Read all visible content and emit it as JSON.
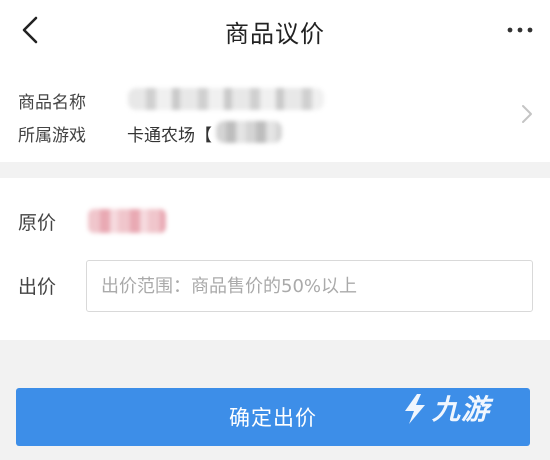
{
  "header": {
    "title": "商品议价",
    "back_icon": "chevron-left-icon",
    "more_icon": "more-horizontal-icon"
  },
  "product": {
    "name_label": "商品名称",
    "game_label": "所属游戏",
    "game_value": "卡通农场【",
    "chevron_icon": "chevron-right-icon"
  },
  "pricing": {
    "original_label": "原价",
    "bid_label": "出价",
    "bid_placeholder": "出价范围：商品售价的50%以上"
  },
  "actions": {
    "confirm_label": "确定出价",
    "confirm_color": "#3d8ee8"
  },
  "watermark": {
    "text": "九游"
  }
}
